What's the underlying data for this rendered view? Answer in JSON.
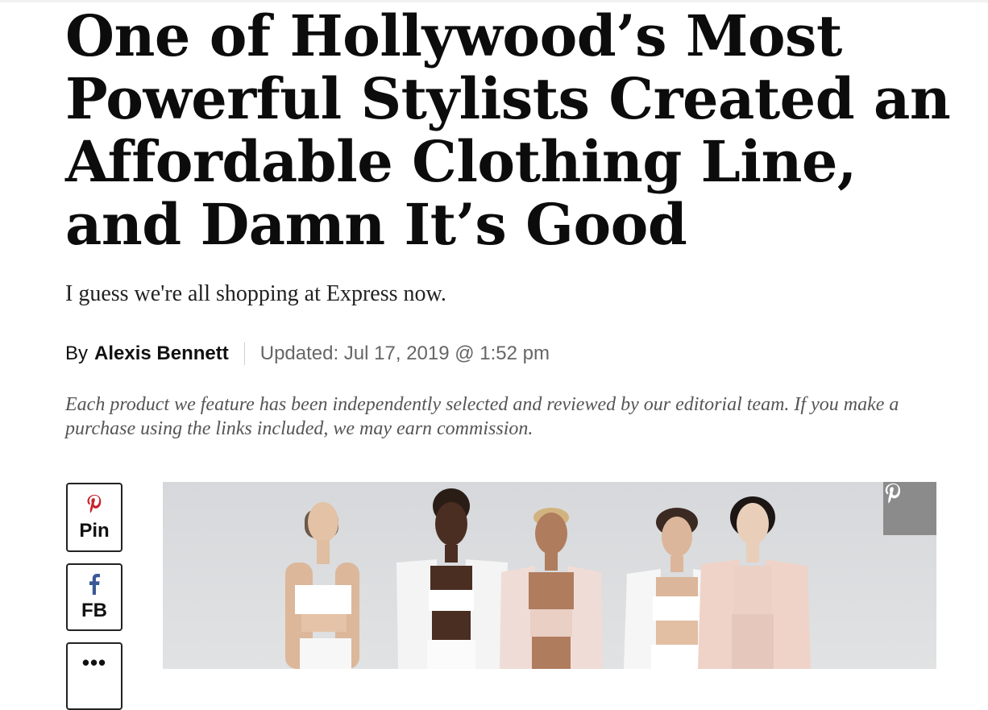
{
  "article": {
    "title": "One of Hollywood’s Most Powerful Stylists Created an Affordable Clothing Line, and Damn It’s Good",
    "dek": "I guess we're all shopping at Express now.",
    "byline_prefix": "By",
    "author": "Alexis Bennett",
    "updated": "Updated: Jul 17, 2019 @ 1:52 pm",
    "disclaimer": "Each product we feature has been independently selected and reviewed by our editorial team. If you make a purchase using the links included, we may earn commission."
  },
  "share": {
    "pin_label": "Pin",
    "fb_label": "FB",
    "more_label": "•••"
  },
  "icons": {
    "pinterest": "pinterest-icon",
    "facebook": "facebook-icon",
    "more": "more-dots-icon"
  },
  "colors": {
    "pinterest_red": "#c8232c",
    "facebook_blue": "#3b5998",
    "pin_overlay": "#8b8b8b",
    "text": "#111111",
    "muted": "#666666"
  }
}
